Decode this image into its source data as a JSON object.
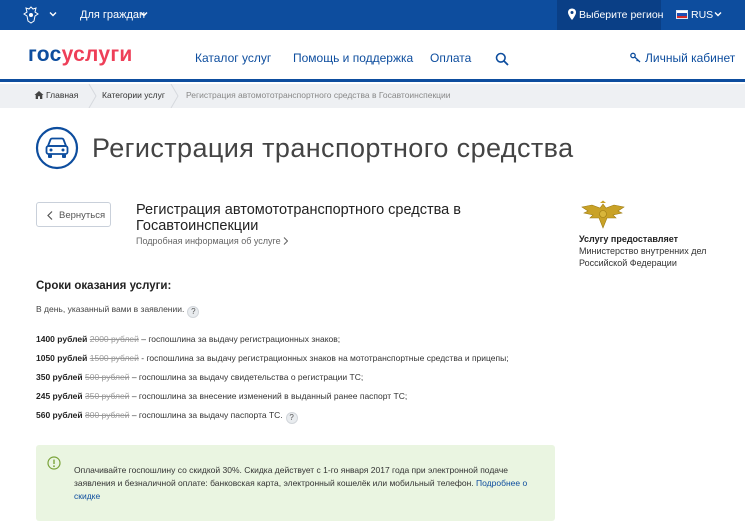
{
  "topbar": {
    "citizens_label": "Для граждан",
    "region_label": "Выберите регион",
    "language": "RUS",
    "bar_color": "#0d4d9e"
  },
  "header": {
    "logo_part1": "гос",
    "logo_part2": "услуги",
    "nav": [
      "Каталог услуг",
      "Помощь и поддержка",
      "Оплата"
    ],
    "cabinet_label": "Личный кабинет",
    "icons": [
      "search-icon",
      "key-icon"
    ]
  },
  "breadcrumb": {
    "items": [
      "Главная",
      "Категории услуг",
      "Регистрация автомототранспортного средства в Госавтоинспекции"
    ]
  },
  "page": {
    "title": "Регистрация транспортного средства",
    "back_label": "Вернуться",
    "service_name": "Регистрация автомототранспортного средства в Госавтоинспекции",
    "more_info": "Подробная информация об услуге"
  },
  "provider": {
    "heading": "Услугу предоставляет",
    "name": "Министерство внутренних дел Российской Федерации"
  },
  "terms": {
    "heading": "Сроки оказания услуги:",
    "text": "В день, указанный вами в заявлении.",
    "help_badge": "?"
  },
  "fees": [
    {
      "price": "1400 рублей",
      "old_price": "2000 рублей",
      "desc": "– госпошлина за выдачу регистрационных знаков;"
    },
    {
      "price": "1050 рублей",
      "old_price": "1500 рублей",
      "desc": "- госпошлина за выдачу регистрационных знаков на мототранспортные средства и прицепы;"
    },
    {
      "price": "350 рублей",
      "old_price": "500 рублей",
      "desc": "– госпошлина за выдачу свидетельства о регистрации ТС;"
    },
    {
      "price": "245 рублей",
      "old_price": "350 рублей",
      "desc": "– госпошлина за внесение изменений в выданный ранее паспорт ТС;"
    },
    {
      "price": "560 рублей",
      "old_price": "800 рублей",
      "desc": "– госпошлина за выдачу паспорта ТС.",
      "help_badge": "?"
    }
  ],
  "discount": {
    "text": "Оплачивайте госпошлину со скидкой 30%. Скидка действует с 1-го января 2017 года при электронной подаче заявления и безналичной оплате: банковская карта, электронный кошелёк или мобильный телефон.",
    "link": "Подробнее о скидке",
    "bg_color": "#eaf5e1"
  }
}
